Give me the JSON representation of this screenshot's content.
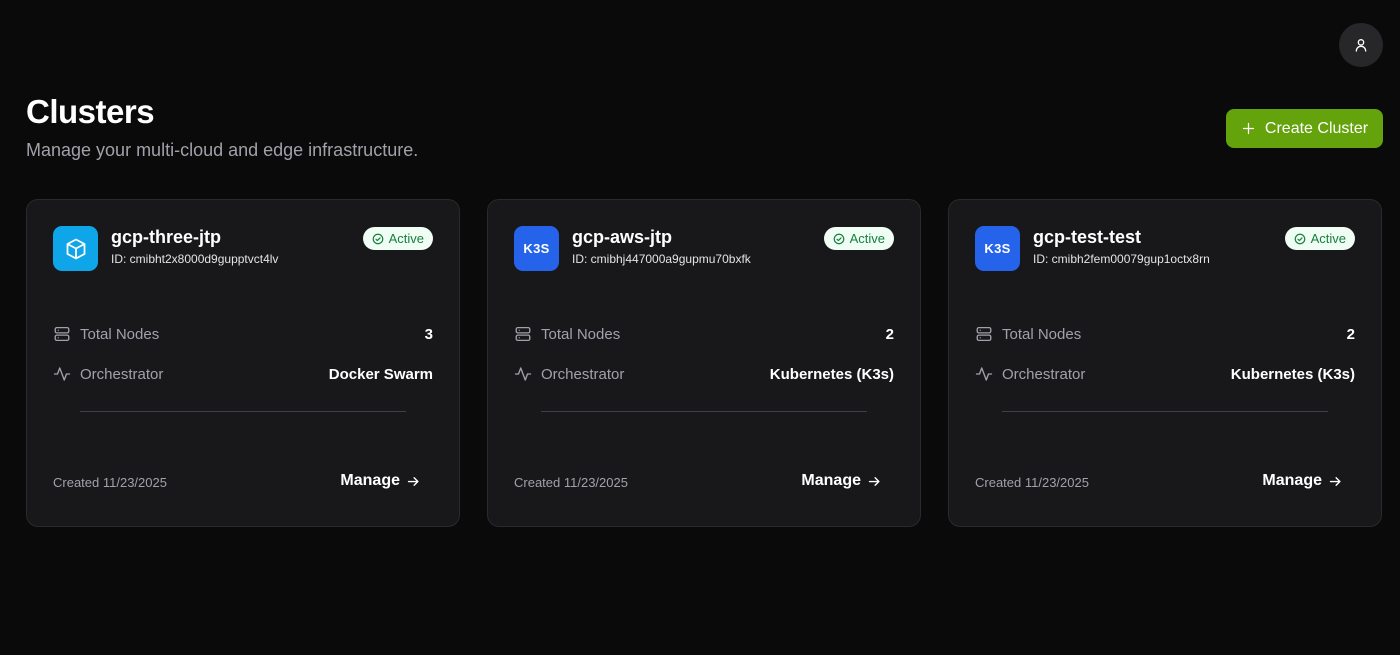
{
  "header": {
    "title": "Clusters",
    "subtitle": "Manage your multi-cloud and edge infrastructure.",
    "create_label": "Create Cluster"
  },
  "colors": {
    "accent": "#65a30d",
    "active_badge_bg": "#f0fdf4",
    "active_badge_text": "#15803d",
    "cube_icon_bg": "#0ea5e9",
    "k3s_icon_bg": "#2563eb"
  },
  "clusters": [
    {
      "name": "gcp-three-jtp",
      "id": "ID: cmibht2x8000d9gupptvct4lv",
      "icon": "cube-icon",
      "status": "Active",
      "nodes_label": "Total Nodes",
      "nodes": "3",
      "orchestrator_label": "Orchestrator",
      "orchestrator": "Docker Swarm",
      "created": "Created 11/23/2025",
      "manage_label": "Manage"
    },
    {
      "name": "gcp-aws-jtp",
      "id": "ID: cmibhj447000a9gupmu70bxfk",
      "icon": "k3s-icon",
      "icon_text": "K3S",
      "status": "Active",
      "nodes_label": "Total Nodes",
      "nodes": "2",
      "orchestrator_label": "Orchestrator",
      "orchestrator": "Kubernetes (K3s)",
      "created": "Created 11/23/2025",
      "manage_label": "Manage"
    },
    {
      "name": "gcp-test-test",
      "id": "ID: cmibh2fem00079gup1octx8rn",
      "icon": "k3s-icon",
      "icon_text": "K3S",
      "status": "Active",
      "nodes_label": "Total Nodes",
      "nodes": "2",
      "orchestrator_label": "Orchestrator",
      "orchestrator": "Kubernetes (K3s)",
      "created": "Created 11/23/2025",
      "manage_label": "Manage"
    }
  ]
}
